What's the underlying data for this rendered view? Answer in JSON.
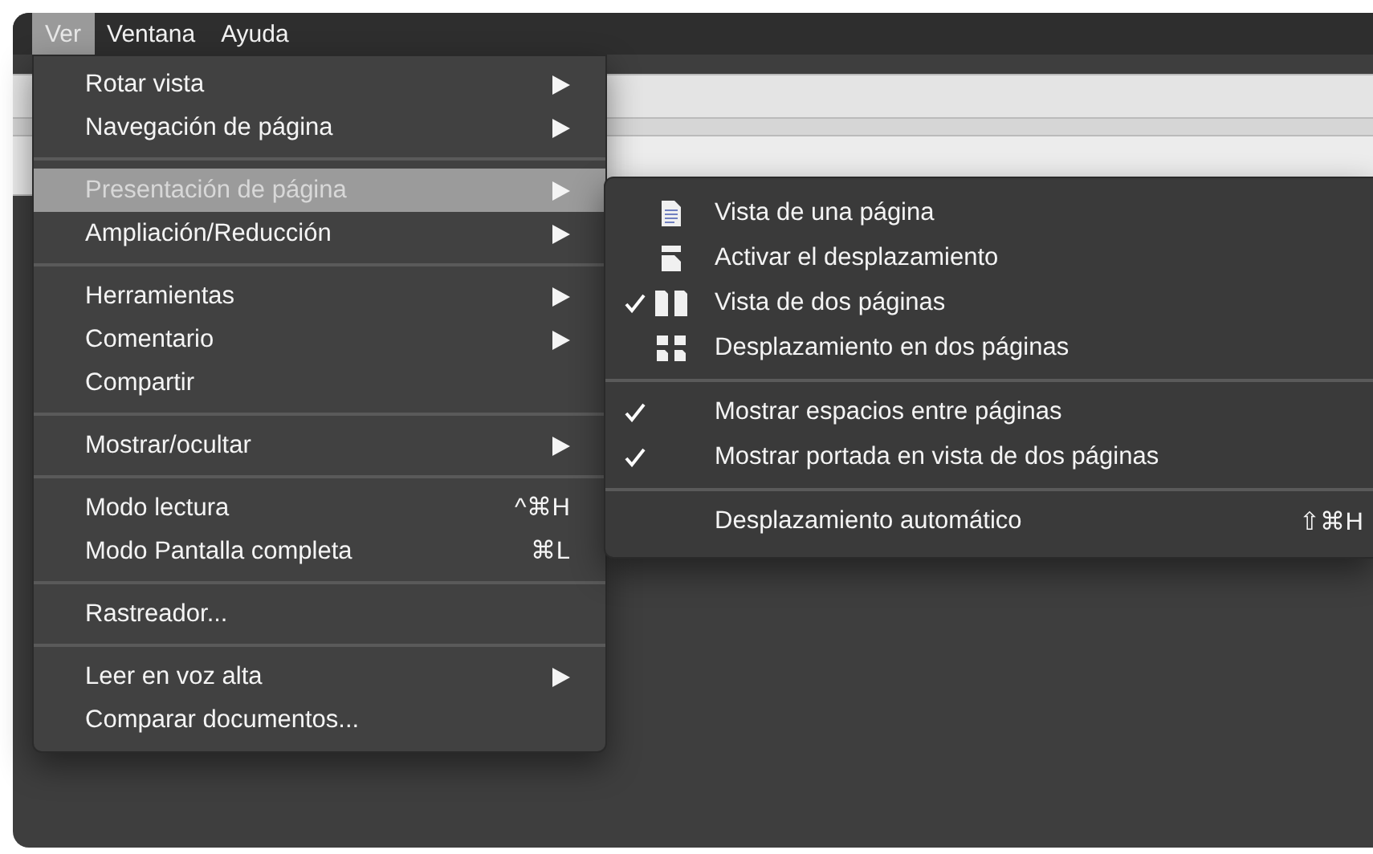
{
  "menu_bar": [
    {
      "label": "Ver",
      "selected": true
    },
    {
      "label": "Ventana",
      "selected": false
    },
    {
      "label": "Ayuda",
      "selected": false
    }
  ],
  "menu": {
    "sections": [
      {
        "items": [
          {
            "label": "Rotar vista",
            "submenu": true,
            "selected": false
          },
          {
            "label": "Navegación de página",
            "submenu": true,
            "selected": false
          }
        ]
      },
      {
        "items": [
          {
            "label": "Presentación de página",
            "submenu": true,
            "selected": true
          },
          {
            "label": "Ampliación/Reducción",
            "submenu": true,
            "selected": false
          }
        ]
      },
      {
        "items": [
          {
            "label": "Herramientas",
            "submenu": true,
            "selected": false
          },
          {
            "label": "Comentario",
            "submenu": true,
            "selected": false
          },
          {
            "label": "Compartir",
            "submenu": false,
            "selected": false
          }
        ]
      },
      {
        "items": [
          {
            "label": "Mostrar/ocultar",
            "submenu": true,
            "selected": false
          }
        ]
      },
      {
        "items": [
          {
            "label": "Modo lectura",
            "submenu": false,
            "selected": false,
            "shortcut": "^⌘H"
          },
          {
            "label": "Modo Pantalla completa",
            "submenu": false,
            "selected": false,
            "shortcut": "⌘L"
          }
        ]
      },
      {
        "items": [
          {
            "label": "Rastreador...",
            "submenu": false,
            "selected": false
          }
        ]
      },
      {
        "items": [
          {
            "label": "Leer en voz alta",
            "submenu": true,
            "selected": false
          },
          {
            "label": "Comparar documentos...",
            "submenu": false,
            "selected": false
          }
        ]
      }
    ]
  },
  "submenu": {
    "sections": [
      {
        "items": [
          {
            "label": "Vista de una página",
            "kind": "single-page",
            "checked": false
          },
          {
            "label": "Activar el desplazamiento",
            "kind": "scroll-page",
            "checked": false
          },
          {
            "label": "Vista de dos páginas",
            "kind": "two-page",
            "checked": true
          },
          {
            "label": "Desplazamiento en dos páginas",
            "kind": "two-page-scroll",
            "checked": false
          }
        ]
      },
      {
        "items": [
          {
            "label": "Mostrar espacios entre páginas",
            "kind": "plain",
            "checked": true
          },
          {
            "label": "Mostrar portada en vista de dos páginas",
            "kind": "plain",
            "checked": true
          }
        ]
      },
      {
        "items": [
          {
            "label": "Desplazamiento automático",
            "kind": "plain",
            "checked": false,
            "shortcut": "⇧⌘H"
          }
        ]
      }
    ]
  }
}
